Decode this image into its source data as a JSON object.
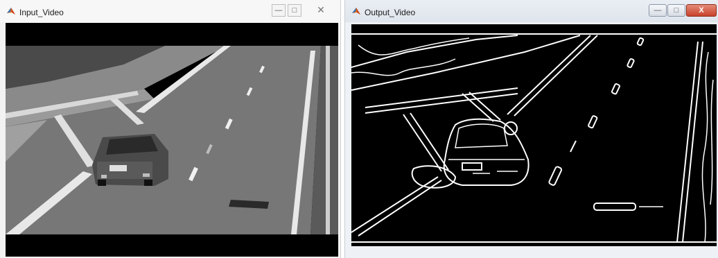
{
  "windows": {
    "input": {
      "title": "Input_Video",
      "minimize_label": "—",
      "maximize_label": "□",
      "close_label": "✕",
      "logo_icon": "matlab-logo-icon"
    },
    "output": {
      "title": "Output_Video",
      "minimize_label": "—",
      "maximize_label": "□",
      "close_label": "X",
      "logo_icon": "matlab-logo-icon"
    }
  },
  "colors": {
    "road": "#7a7a7a",
    "edge": "#ffffff",
    "frame": "#000000",
    "close_red": "#c7422b"
  }
}
